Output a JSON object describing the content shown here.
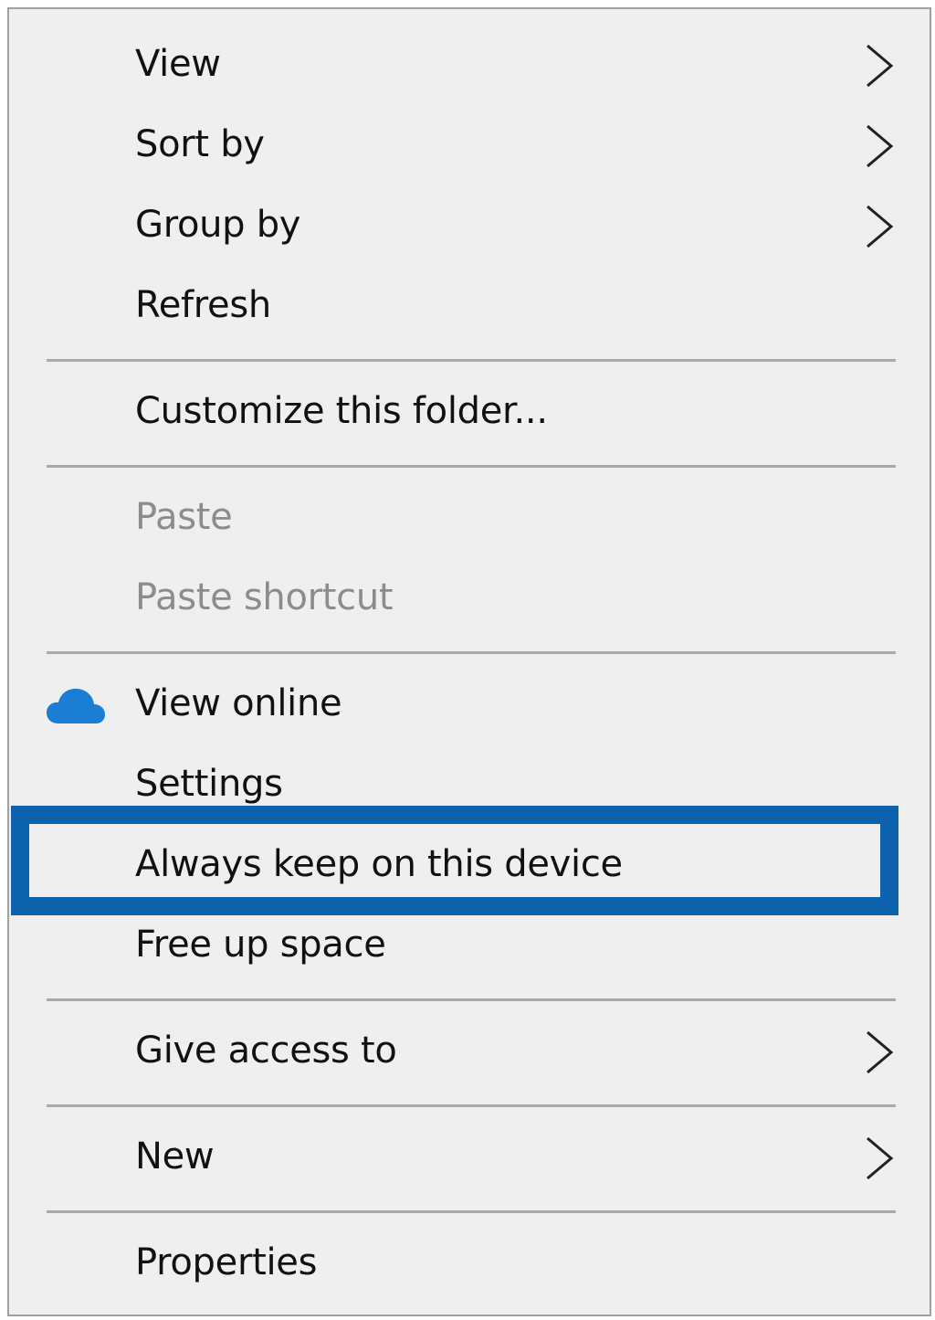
{
  "menu": {
    "items": [
      {
        "label": "View"
      },
      {
        "label": "Sort by"
      },
      {
        "label": "Group by"
      },
      {
        "label": "Refresh"
      },
      {
        "label": "Customize this folder..."
      },
      {
        "label": "Paste"
      },
      {
        "label": "Paste shortcut"
      },
      {
        "label": "View online"
      },
      {
        "label": "Settings"
      },
      {
        "label": "Always keep on this device"
      },
      {
        "label": "Free up space"
      },
      {
        "label": "Give access to"
      },
      {
        "label": "New"
      },
      {
        "label": "Properties"
      }
    ],
    "icons": {
      "submenu": "chevron-right-icon",
      "view_online": "onedrive-cloud-icon"
    },
    "colors": {
      "background": "#efefef",
      "text": "#111111",
      "disabled_text": "#8c8c8c",
      "separator": "#a9a9a9",
      "highlight_border": "#0d62ad",
      "cloud": "#1a7fd4"
    }
  }
}
